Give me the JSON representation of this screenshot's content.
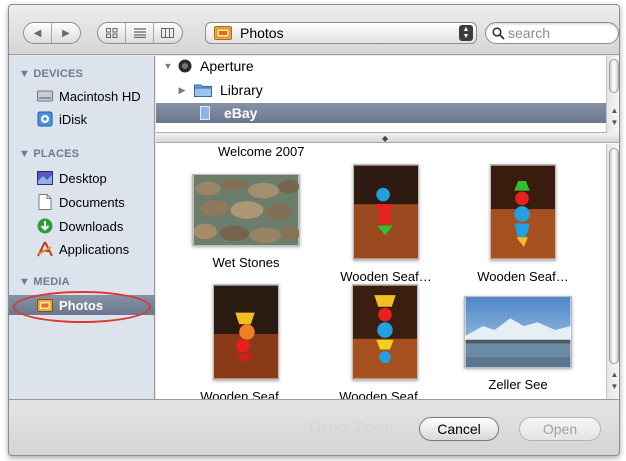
{
  "toolbar": {
    "back_glyph": "◀",
    "forward_glyph": "▶",
    "view_icons": [
      "icon-view-icon",
      "list-view-icon",
      "column-view-icon"
    ],
    "location": {
      "label": "Photos",
      "icon": "photos-folder-icon"
    },
    "search": {
      "placeholder": "search"
    }
  },
  "sidebar": {
    "sections": [
      {
        "title": "▼ DEVICES",
        "items": [
          {
            "label": "Macintosh HD",
            "icon": "hard-drive-icon"
          },
          {
            "label": "iDisk",
            "icon": "idisk-icon"
          }
        ]
      },
      {
        "title": "▼ PLACES",
        "items": [
          {
            "label": "Desktop",
            "icon": "desktop-icon"
          },
          {
            "label": "Documents",
            "icon": "documents-icon"
          },
          {
            "label": "Downloads",
            "icon": "downloads-icon"
          },
          {
            "label": "Applications",
            "icon": "applications-icon"
          }
        ]
      },
      {
        "title": "▼ MEDIA",
        "items": [
          {
            "label": "Photos",
            "icon": "photos-folder-icon",
            "selected": true
          }
        ]
      }
    ]
  },
  "tree": {
    "rows": [
      {
        "label": "Aperture",
        "disclosure": "▼",
        "icon": "aperture-icon"
      },
      {
        "label": "Library",
        "disclosure": "▶",
        "icon": "folder-icon"
      },
      {
        "label": "eBay",
        "disclosure": "",
        "icon": "album-icon",
        "selected": true
      }
    ]
  },
  "grid": {
    "top_caption": "Welcome 2007",
    "photos": [
      {
        "caption": "Wet Stones"
      },
      {
        "caption": "Wooden Seaf…"
      },
      {
        "caption": "Wooden Seaf…"
      },
      {
        "caption": "Wooden Seaf…"
      },
      {
        "caption": "Wooden Seaf…"
      },
      {
        "caption": "Zeller See"
      }
    ]
  },
  "footer": {
    "watermark": "Drop Zone",
    "cancel_label": "Cancel",
    "open_label": "Open"
  },
  "colors": {
    "selection": "#6a778e",
    "sidebar_bg": "#dde3ec",
    "highlight_ring": "#d93b2b"
  }
}
